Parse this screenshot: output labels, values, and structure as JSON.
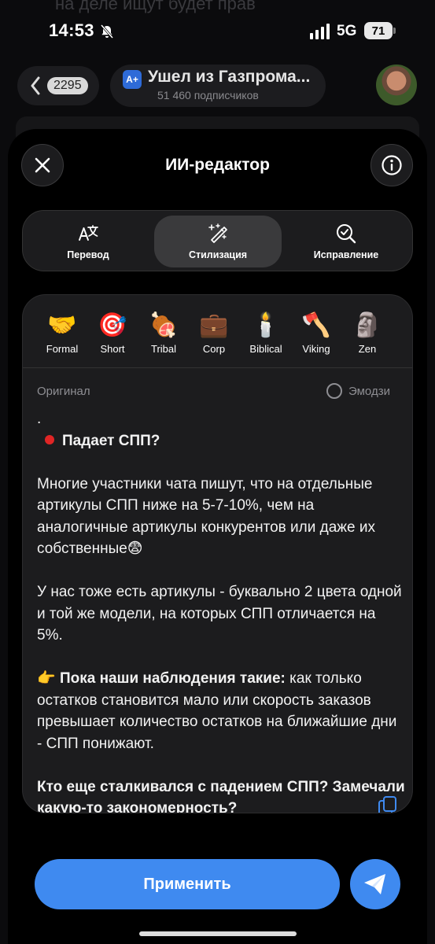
{
  "status_bar": {
    "time": "14:53",
    "network": "5G",
    "battery": "71"
  },
  "background_chat": {
    "ghost_text": "на деле ищут будет прав",
    "back_count": "2295",
    "channel_logo": "A+",
    "channel_title": "Ушел из Газпрома...",
    "channel_subscribers": "51 460 подписчиков"
  },
  "sheet": {
    "title": "ИИ-редактор",
    "tabs": [
      {
        "label": "Перевод",
        "icon": "translate-icon",
        "active": false
      },
      {
        "label": "Стилизация",
        "icon": "magic-wand-icon",
        "active": true
      },
      {
        "label": "Исправление",
        "icon": "spellcheck-icon",
        "active": false
      }
    ],
    "styles": [
      {
        "emoji": "🤝",
        "label": "Formal"
      },
      {
        "emoji": "🎯",
        "label": "Short"
      },
      {
        "emoji": "🍖",
        "label": "Tribal"
      },
      {
        "emoji": "💼",
        "label": "Corp"
      },
      {
        "emoji": "🕯️",
        "label": "Biblical"
      },
      {
        "emoji": "🪓",
        "label": "Viking"
      },
      {
        "emoji": "🗿",
        "label": "Zen"
      }
    ],
    "original_label": "Оригинал",
    "emoji_toggle_label": "Эмодзи",
    "text": {
      "dot": ".",
      "heading": "Падает СПП?",
      "p1": "Многие участники чата пишут, что на отдельные артикулы СПП ниже на 5-7-10%, чем на аналогичные артикулы конкурентов или даже их собственные😨",
      "p2": "У нас тоже есть артикулы - буквально 2 цвета одной и той же модели, на которых СПП отличается на 5%.",
      "p3_emoji": "👉",
      "p3_bold": "Пока наши наблюдения такие:",
      "p3_rest": " как только остатков становится мало или скорость заказов превышает количество остатков на ближайшие дни - СПП понижают.",
      "p4": "Кто еще сталкивался с падением СПП? Замечали какую-то закономерность?"
    },
    "apply_label": "Применить"
  },
  "colors": {
    "accent": "#3f8af0",
    "card_bg": "#1c1c1e",
    "red_dot": "#e02525"
  }
}
